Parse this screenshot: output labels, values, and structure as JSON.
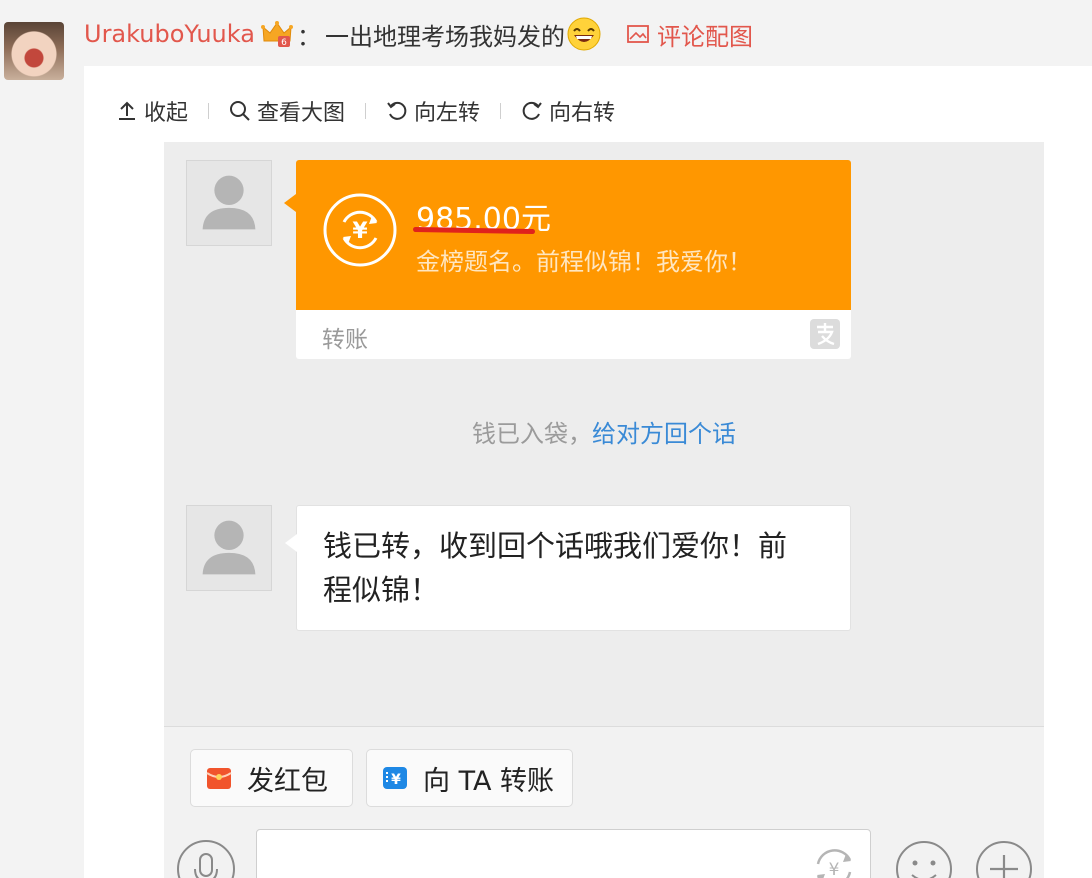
{
  "comment": {
    "username": "UrakuboYuuka",
    "colon": "：",
    "text": "一出地理考场我妈发的",
    "image_link_label": "评论配图"
  },
  "toolbar": {
    "collapse_label": "收起",
    "view_large_label": "查看大图",
    "rotate_left_label": "向左转",
    "rotate_right_label": "向右转"
  },
  "chat": {
    "transfer": {
      "amount": "985.00元",
      "note": "金榜题名。前程似锦！我爱你！",
      "label": "转账"
    },
    "notice": {
      "text": "钱已入袋，",
      "link": "给对方回个话"
    },
    "reply": {
      "text": "钱已转，收到回个话哦我们爱你！前程似锦！"
    },
    "actions": {
      "red_packet": "发红包",
      "transfer_to": "向 TA 转账"
    }
  },
  "colors": {
    "username": "#e2574c",
    "transfer_orange": "#ff9700",
    "link_blue": "#3a8ad6"
  },
  "icons": [
    "vip-crown-icon",
    "grin-emoji-icon",
    "picture-icon",
    "upload-arrow-icon",
    "search-icon",
    "rotate-left-icon",
    "rotate-right-icon",
    "default-avatar-icon",
    "yuan-exchange-icon",
    "alipay-icon",
    "red-packet-icon",
    "transfer-icon",
    "voice-icon",
    "emoji-icon",
    "plus-icon"
  ]
}
